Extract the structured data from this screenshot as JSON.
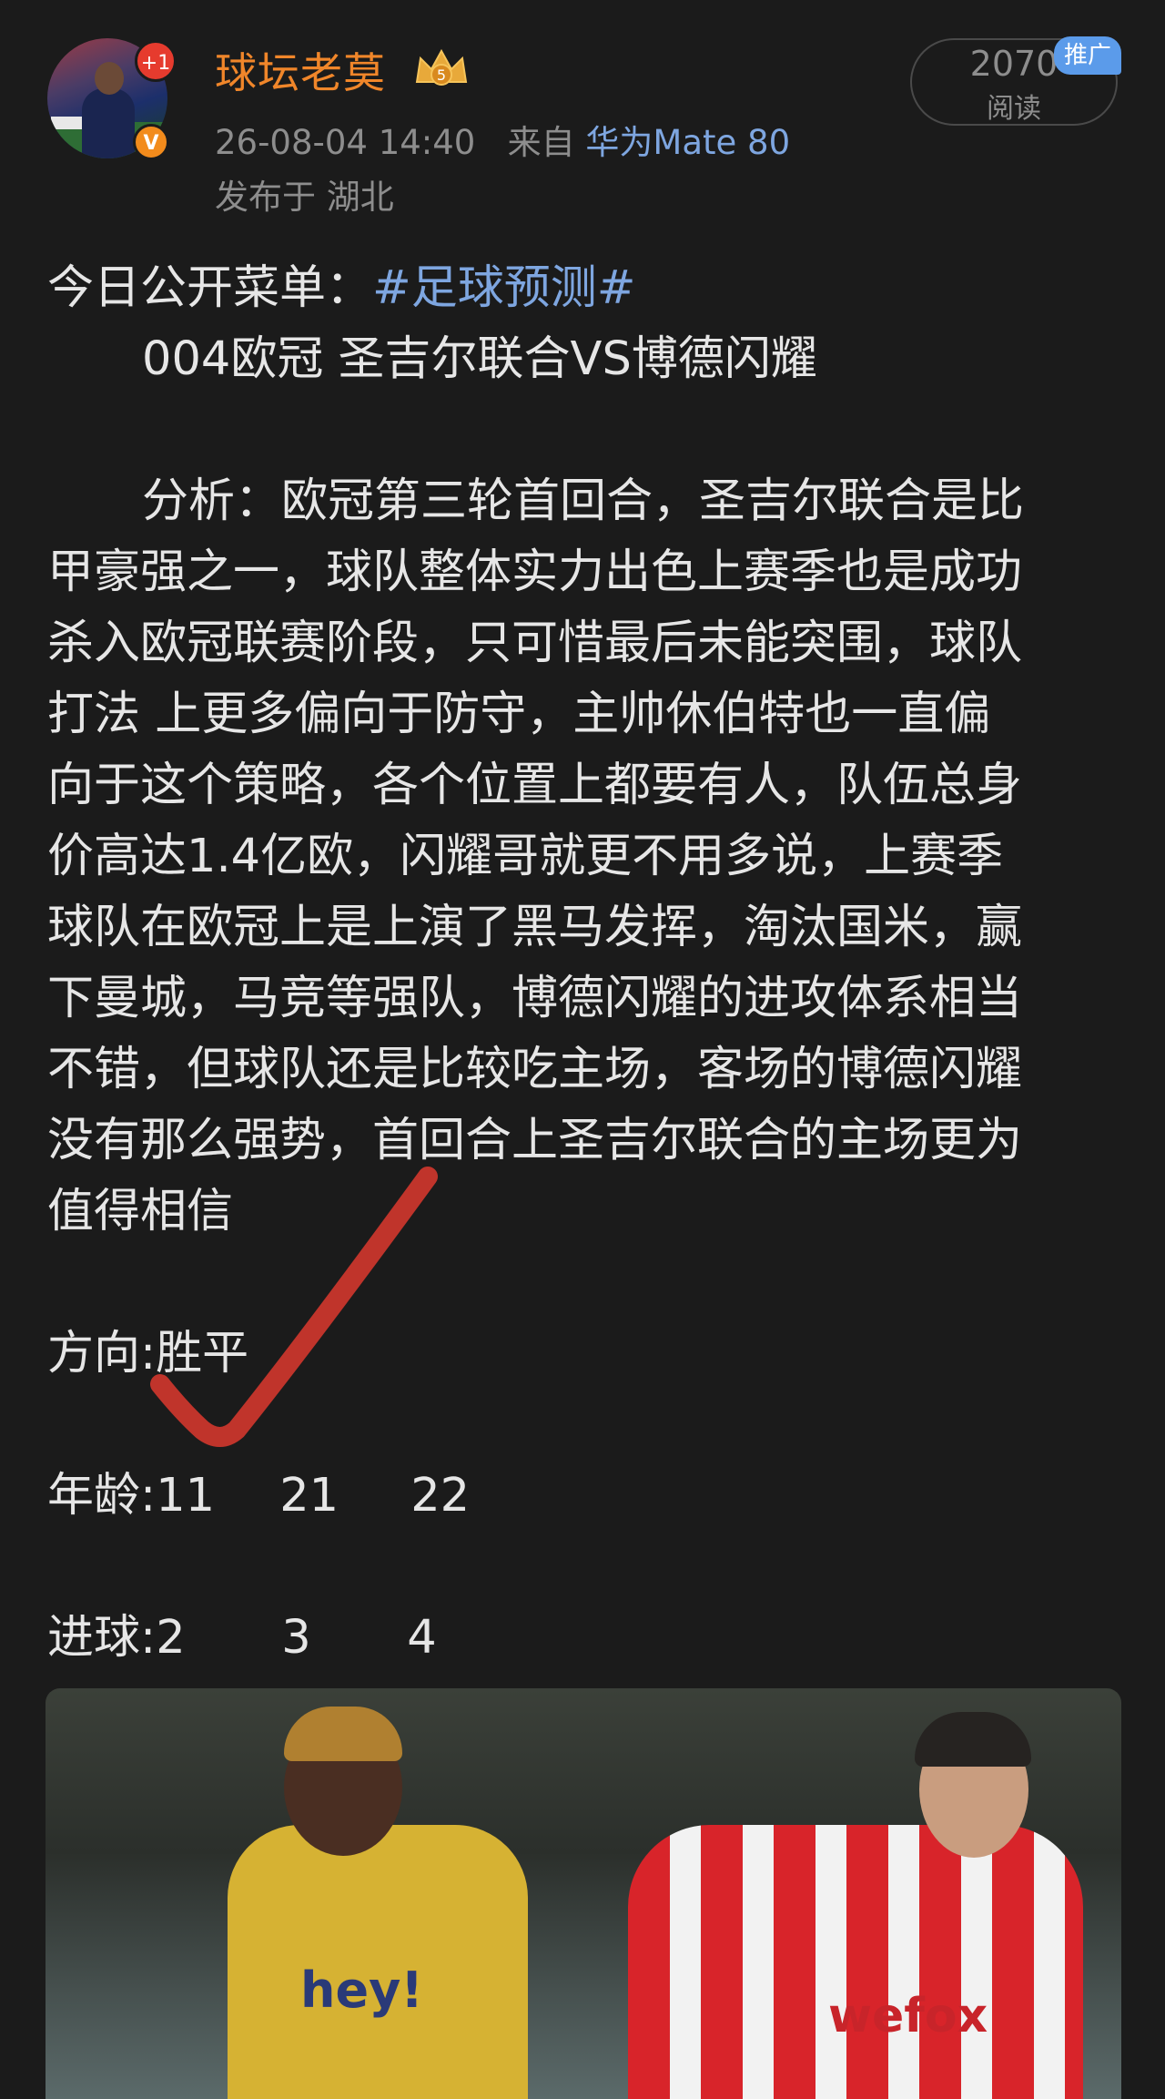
{
  "header": {
    "username": "球坛老莫",
    "crown_level": "5",
    "avatar_badge": "+1",
    "verified_badge": "V",
    "timestamp": "26-08-04 14:40",
    "source_prefix": "来自",
    "device": "华为Mate 80",
    "location": "发布于 湖北",
    "reads_count": "2070",
    "reads_label": "阅读",
    "promo_tag": "推广"
  },
  "post": {
    "intro_label": "今日公开菜单：",
    "hashtag": "#足球预测#",
    "match_line": "004欧冠 圣吉尔联合VS博德闪耀",
    "analysis_lines": [
      "分析：欧冠第三轮首回合，圣吉尔联合是比",
      "甲豪强之一，球队整体实力出色上赛季也是成功",
      "杀入欧冠联赛阶段，只可惜最后未能突围，球队",
      "打法 上更多偏向于防守，主帅休伯特也一直偏",
      "向于这个策略，各个位置上都要有人，队伍总身",
      "价高达1.4亿欧，闪耀哥就更不用多说，上赛季",
      "球队在欧冠上是上演了黑马发挥，淘汰国米，赢",
      "下曼城，马竞等强队，博德闪耀的进攻体系相当",
      "不错，但球队还是比较吃主场，客场的博德闪耀",
      "没有那么强势，首回合上圣吉尔联合的主场更为",
      "值得相信"
    ],
    "direction_label": "方向:胜平",
    "age_label": "年龄:",
    "age_values": [
      "11",
      "21",
      "22"
    ],
    "goals_label": "进球:",
    "goals_values": [
      "2",
      "3",
      "4"
    ]
  },
  "photo": {
    "jersey_text": "hey!",
    "sponsor_text": "wefox"
  },
  "colors": {
    "background": "#1b1b1b",
    "username": "#f0862a",
    "link": "#7ea6e0",
    "check_mark": "#c0342b"
  }
}
